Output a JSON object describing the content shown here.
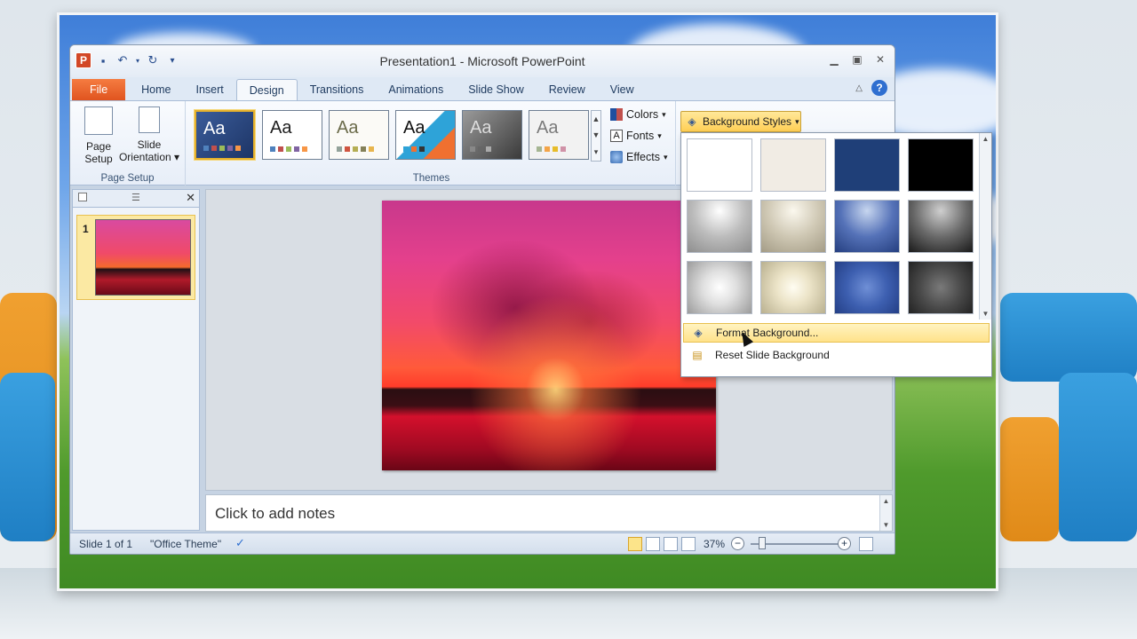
{
  "window": {
    "title": "Presentation1 - Microsoft PowerPoint",
    "qat_icons": [
      "powerpoint-logo-icon",
      "save-icon",
      "undo-icon",
      "redo-icon",
      "customize-qat-icon"
    ]
  },
  "tabs": [
    {
      "label": "File"
    },
    {
      "label": "Home"
    },
    {
      "label": "Insert"
    },
    {
      "label": "Design"
    },
    {
      "label": "Transitions"
    },
    {
      "label": "Animations"
    },
    {
      "label": "Slide Show"
    },
    {
      "label": "Review"
    },
    {
      "label": "View"
    }
  ],
  "ribbon": {
    "page_setup": {
      "group_label": "Page Setup",
      "page_setup_line1": "Page",
      "page_setup_line2": "Setup",
      "slide_orientation_line1": "Slide",
      "slide_orientation_line2": "Orientation ▾"
    },
    "themes": {
      "group_label": "Themes",
      "aa": "Aa",
      "colors": "Colors",
      "fonts": "Fonts",
      "effects": "Effects"
    },
    "background_styles": "Background Styles"
  },
  "dropdown": {
    "swatch_colors": [
      "#ffffff",
      "#f1ece4",
      "#1f3f78",
      "#000000",
      "gray-radial",
      "beige-radial",
      "blue-radial",
      "black-radial",
      "silver-center",
      "cream-center",
      "blue-center",
      "dark-center"
    ],
    "format_background": "Format Background...",
    "reset_background": "Reset Slide Background"
  },
  "slides_panel": {
    "slide_number": "1"
  },
  "notes": {
    "placeholder": "Click to add notes"
  },
  "statusbar": {
    "slide_info": "Slide 1 of 1",
    "theme": "\"Office Theme\"",
    "zoom": "37%",
    "zoom_out": "−",
    "zoom_in": "+"
  },
  "colors": {
    "accent_file_tab": "#e0541f",
    "selection_gold": "#ffcf55"
  }
}
